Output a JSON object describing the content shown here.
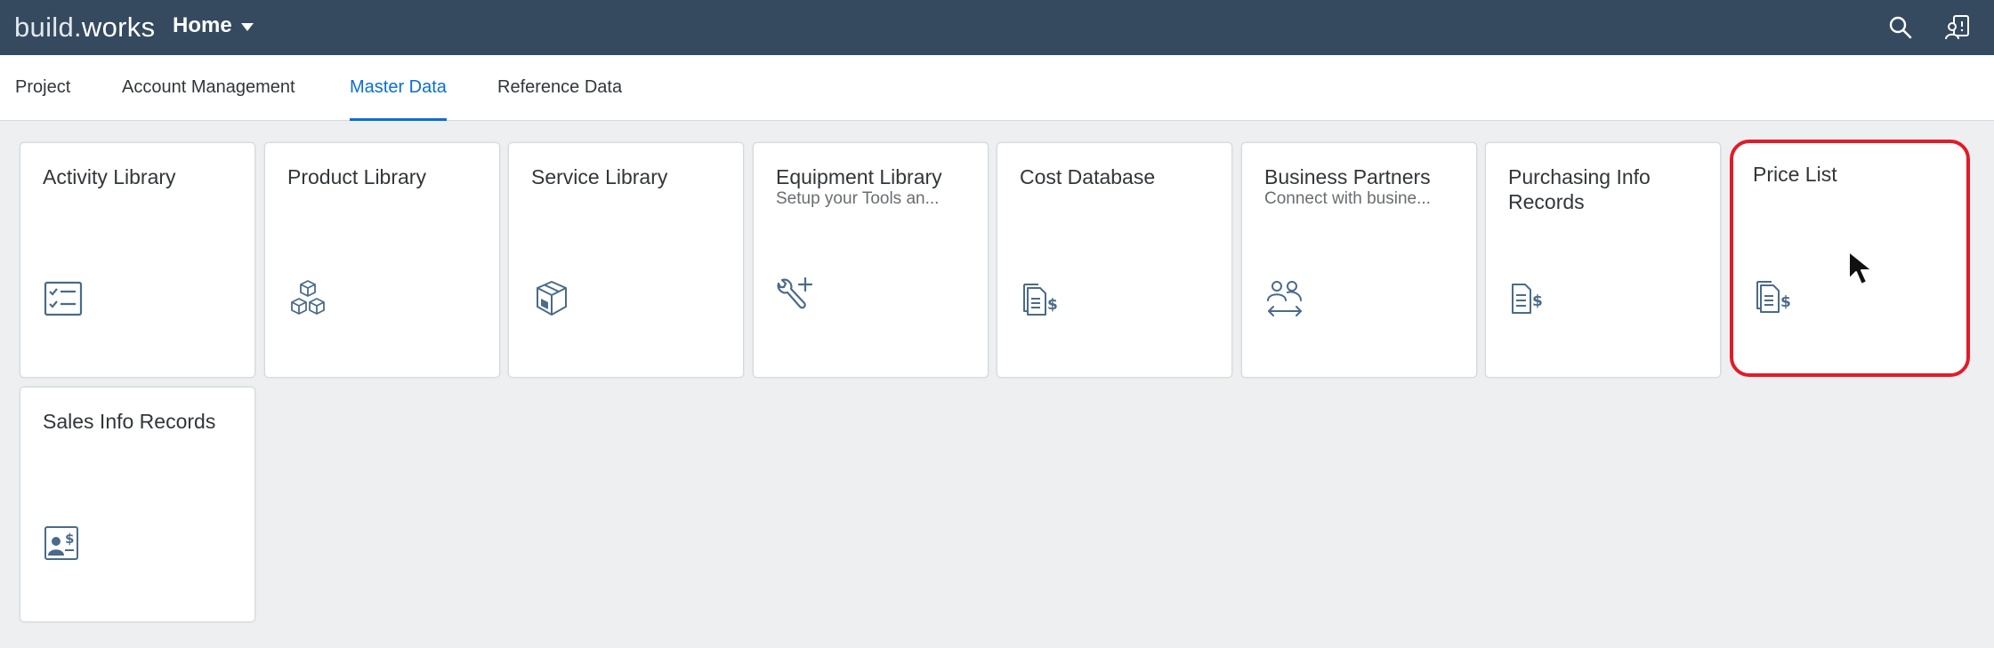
{
  "shell": {
    "logo_part1": "build",
    "logo_dot": ".",
    "logo_part2": "works",
    "home_label": "Home",
    "bg_color": "#354a5f"
  },
  "tabs": [
    {
      "label": "Project",
      "active": false
    },
    {
      "label": "Account Management",
      "active": false
    },
    {
      "label": "Master Data",
      "active": true
    },
    {
      "label": "Reference Data",
      "active": false
    }
  ],
  "accent_color": "#0a6ed1",
  "highlight_color": "#e21b28",
  "tiles": [
    {
      "title": "Activity Library",
      "subtitle": "",
      "icon": "checklist-icon"
    },
    {
      "title": "Product Library",
      "subtitle": "",
      "icon": "cubes-icon"
    },
    {
      "title": "Service Library",
      "subtitle": "",
      "icon": "package-icon"
    },
    {
      "title": "Equipment Library",
      "subtitle": "Setup your Tools an...",
      "icon": "wrench-add-icon"
    },
    {
      "title": "Cost Database",
      "subtitle": "",
      "icon": "document-dollar-icon"
    },
    {
      "title": "Business Partners",
      "subtitle": "Connect with busine...",
      "icon": "people-exchange-icon"
    },
    {
      "title": "Purchasing Info Records",
      "subtitle": "",
      "icon": "invoice-dollar-icon"
    },
    {
      "title": "Price List",
      "subtitle": "",
      "icon": "document-dollar-icon",
      "highlighted": true
    },
    {
      "title": "Sales Info Records",
      "subtitle": "",
      "icon": "contact-dollar-icon"
    }
  ]
}
